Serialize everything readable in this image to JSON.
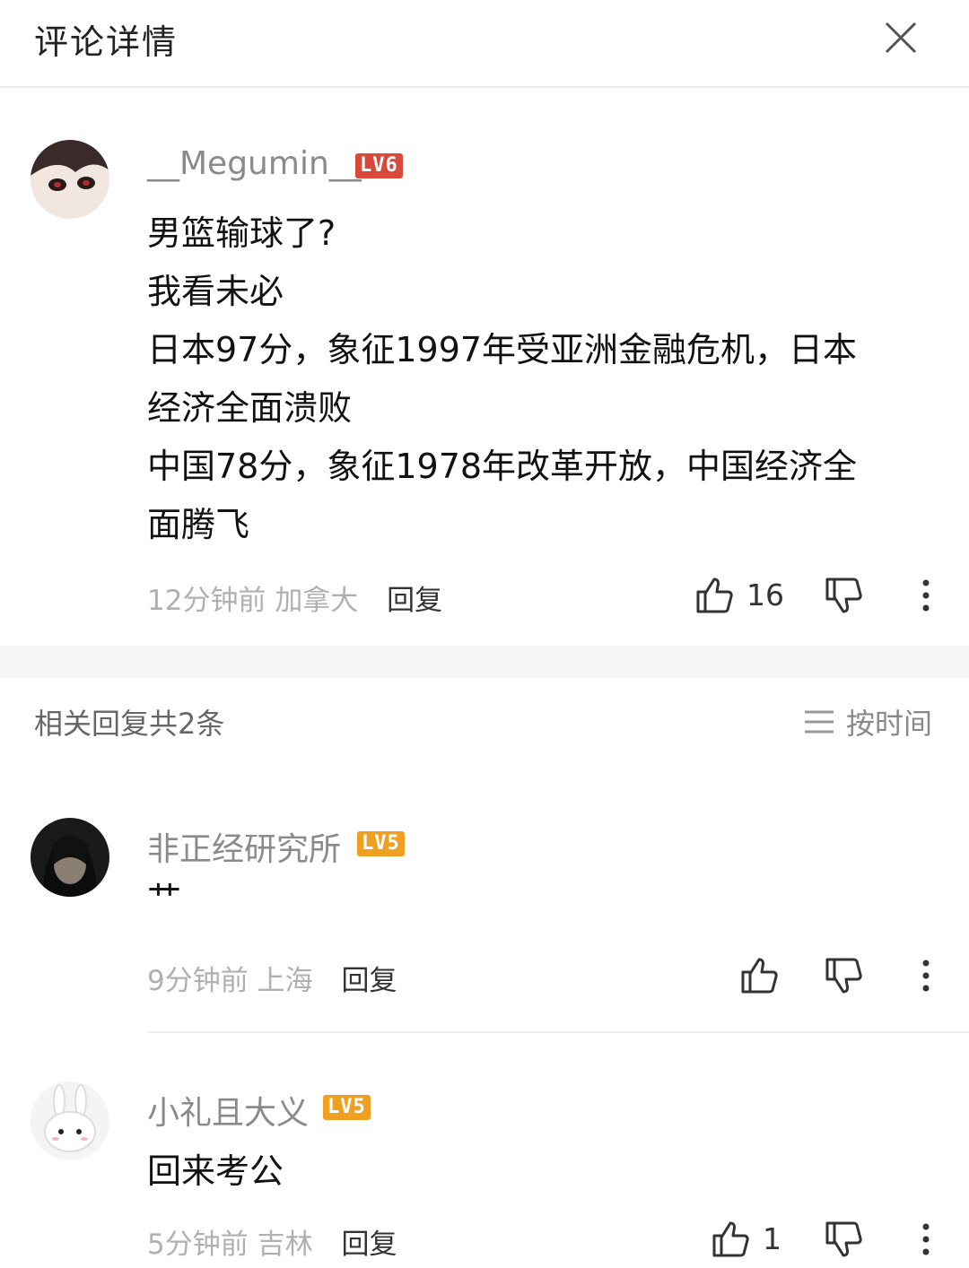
{
  "header": {
    "title": "评论详情",
    "close_icon": "close-icon"
  },
  "main_comment": {
    "username": "__Megumin__",
    "level": "LV6",
    "lines": [
      "男篮输球了?",
      "我看未必",
      "日本97分，象征1997年受亚洲金融危机，日本",
      "经济全面溃败",
      "中国78分，象征1978年改革开放，中国经济全",
      "面腾飞"
    ],
    "time": "12分钟前",
    "location": "加拿大",
    "reply_label": "回复",
    "likes": "16"
  },
  "replies_section": {
    "title": "相关回复共2条",
    "sort_label": "按时间"
  },
  "replies": [
    {
      "username": "非正经研究所",
      "level": "LV5",
      "text": "艹",
      "time": "9分钟前",
      "location": "上海",
      "reply_label": "回复",
      "likes": ""
    },
    {
      "username": "小礼且大义",
      "level": "LV5",
      "text": "回来考公",
      "time": "5分钟前",
      "location": "吉林",
      "reply_label": "回复",
      "likes": "1"
    }
  ]
}
